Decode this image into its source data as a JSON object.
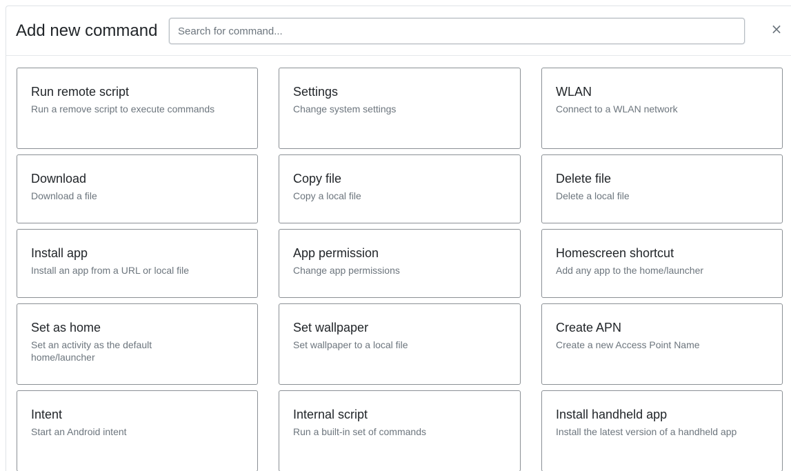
{
  "header": {
    "title": "Add new command",
    "search_placeholder": "Search for command...",
    "search_value": "",
    "close_label": "×"
  },
  "commands": [
    {
      "title": "Run remote script",
      "description": "Run a remove script to execute commands"
    },
    {
      "title": "Settings",
      "description": "Change system settings"
    },
    {
      "title": "WLAN",
      "description": "Connect to a WLAN network"
    },
    {
      "title": "Download",
      "description": "Download a file"
    },
    {
      "title": "Copy file",
      "description": "Copy a local file"
    },
    {
      "title": "Delete file",
      "description": "Delete a local file"
    },
    {
      "title": "Install app",
      "description": "Install an app from a URL or local file"
    },
    {
      "title": "App permission",
      "description": "Change app permissions"
    },
    {
      "title": "Homescreen shortcut",
      "description": "Add any app to the home/launcher"
    },
    {
      "title": "Set as home",
      "description": "Set an activity as the default home/launcher"
    },
    {
      "title": "Set wallpaper",
      "description": "Set wallpaper to a local file"
    },
    {
      "title": "Create APN",
      "description": "Create a new Access Point Name"
    },
    {
      "title": "Intent",
      "description": "Start an Android intent"
    },
    {
      "title": "Internal script",
      "description": "Run a built-in set of commands"
    },
    {
      "title": "Install handheld app",
      "description": "Install the latest version of a handheld app"
    }
  ],
  "colors": {
    "border": "#8a8f94",
    "title_text": "#212529",
    "muted_text": "#6c757d"
  }
}
